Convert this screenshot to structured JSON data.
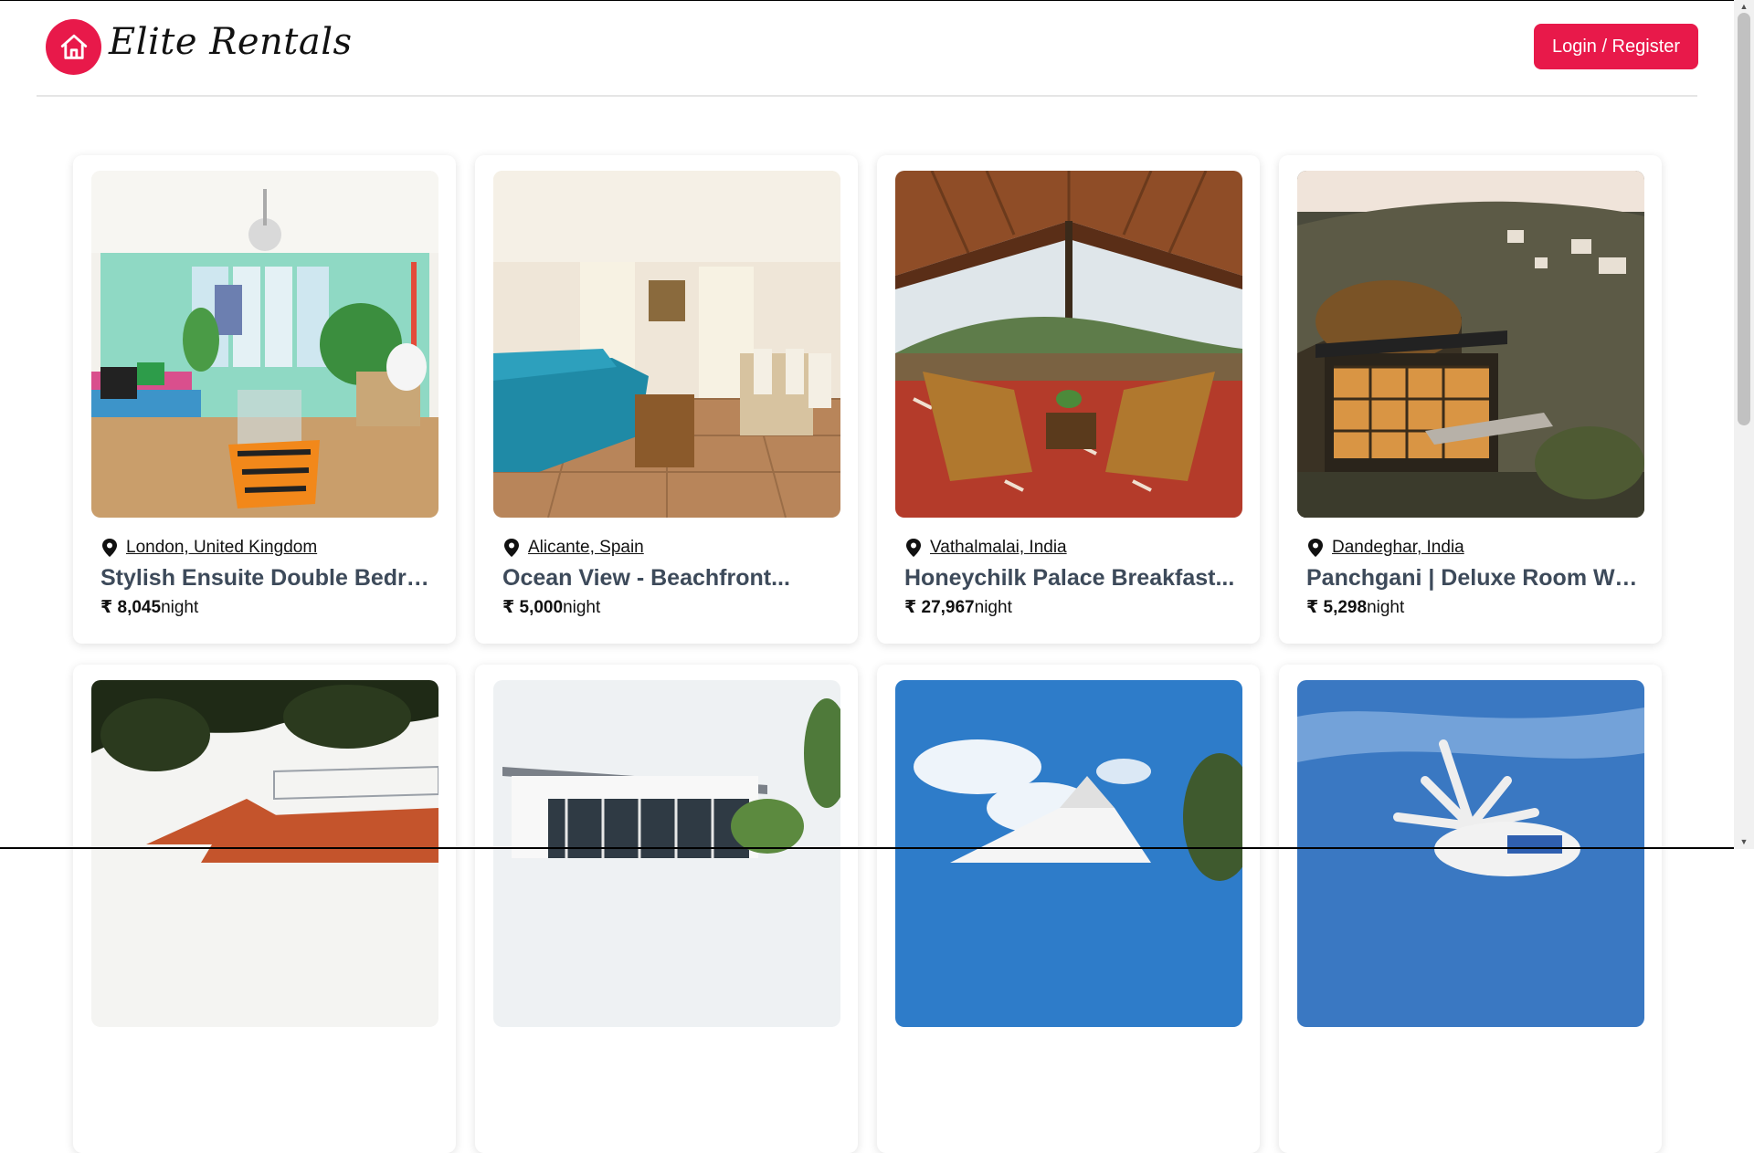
{
  "header": {
    "brand": "Elite Rentals",
    "login_label": "Login / Register"
  },
  "colors": {
    "accent": "#e8194a",
    "title_text": "#3d4a5a"
  },
  "listings": [
    {
      "location": "London, United Kingdom",
      "title": "Stylish Ensuite Double Bedroo...",
      "currency": "₹",
      "price": "8,045",
      "unit": "night"
    },
    {
      "location": "Alicante, Spain",
      "title": "Ocean View - Beachfront...",
      "currency": "₹",
      "price": "5,000",
      "unit": "night"
    },
    {
      "location": "Vathalmalai, India",
      "title": "Honeychilk Palace Breakfast...",
      "currency": "₹",
      "price": "27,967",
      "unit": "night"
    },
    {
      "location": "Dandeghar, India",
      "title": "Panchgani | Deluxe Room With...",
      "currency": "₹",
      "price": "5,298",
      "unit": "night"
    }
  ],
  "icons": {
    "logo": "house-icon",
    "location": "map-pin-icon"
  }
}
